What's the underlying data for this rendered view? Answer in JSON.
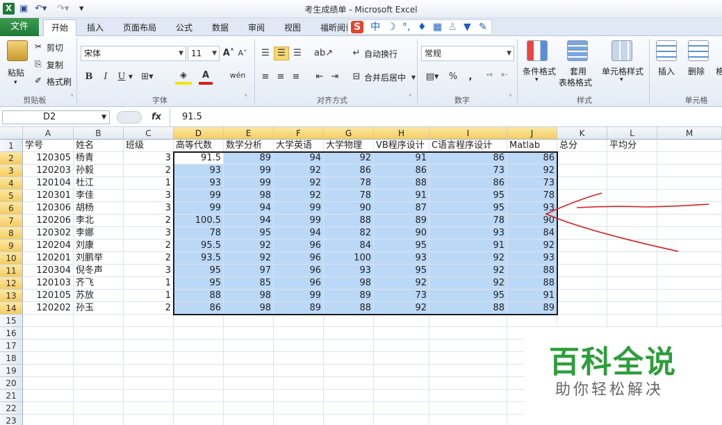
{
  "window": {
    "title": "考生成绩单 - Microsoft Excel"
  },
  "tabs": [
    "文件",
    "开始",
    "插入",
    "页面布局",
    "公式",
    "数据",
    "审阅",
    "视图",
    "福昕阅读"
  ],
  "ime": {
    "label": "中"
  },
  "ribbon": {
    "clipboard": {
      "paste": "粘贴",
      "cut": "剪切",
      "copy": "复制",
      "format_painter": "格式刷",
      "label": "剪贴板"
    },
    "font": {
      "name": "宋体",
      "size": "11",
      "label": "字体",
      "bold": "B",
      "italic": "I",
      "underline": "U"
    },
    "alignment": {
      "wrap": "自动换行",
      "merge": "合并后居中",
      "label": "对齐方式"
    },
    "number": {
      "format": "常规",
      "percent": "%",
      "comma": ",",
      "label": "数字"
    },
    "styles": {
      "conditional": "条件格式",
      "table_format_1": "套用",
      "table_format_2": "表格格式",
      "cell_styles": "单元格样式",
      "label": "样式"
    },
    "cells": {
      "insert": "插入",
      "delete": "删除",
      "format": "格",
      "label": "单元格"
    }
  },
  "formula_bar": {
    "name_box": "D2",
    "fx": "fx",
    "value": "91.5"
  },
  "columns": [
    "A",
    "B",
    "C",
    "D",
    "E",
    "F",
    "G",
    "H",
    "I",
    "J",
    "K",
    "L",
    "M"
  ],
  "rows": [
    "1",
    "2",
    "3",
    "4",
    "5",
    "6",
    "7",
    "8",
    "9",
    "10",
    "11",
    "12",
    "13",
    "14",
    "15",
    "16",
    "17",
    "18",
    "19",
    "20",
    "21",
    "22",
    "23"
  ],
  "headers": [
    "学号",
    "姓名",
    "班级",
    "高等代数",
    "数学分析",
    "大学英语",
    "大学物理",
    "VB程序设计",
    "C语言程序设计",
    "Matlab",
    "总分",
    "平均分",
    ""
  ],
  "table": [
    [
      "120305",
      "杨青",
      "3",
      "91.5",
      "89",
      "94",
      "92",
      "91",
      "86",
      "86"
    ],
    [
      "120203",
      "孙毅",
      "2",
      "93",
      "99",
      "92",
      "86",
      "86",
      "73",
      "92"
    ],
    [
      "120104",
      "杜江",
      "1",
      "93",
      "99",
      "92",
      "78",
      "88",
      "86",
      "73"
    ],
    [
      "120301",
      "李佳",
      "3",
      "99",
      "98",
      "92",
      "78",
      "91",
      "95",
      "78"
    ],
    [
      "120306",
      "胡杨",
      "3",
      "99",
      "94",
      "99",
      "90",
      "87",
      "95",
      "93"
    ],
    [
      "120206",
      "李北",
      "2",
      "100.5",
      "94",
      "99",
      "88",
      "89",
      "78",
      "90"
    ],
    [
      "120302",
      "李娜",
      "3",
      "78",
      "95",
      "94",
      "82",
      "90",
      "93",
      "84"
    ],
    [
      "120204",
      "刘康",
      "2",
      "95.5",
      "92",
      "96",
      "84",
      "95",
      "91",
      "92"
    ],
    [
      "120201",
      "刘鹏举",
      "2",
      "93.5",
      "92",
      "96",
      "100",
      "93",
      "92",
      "93"
    ],
    [
      "120304",
      "倪冬声",
      "3",
      "95",
      "97",
      "96",
      "93",
      "95",
      "92",
      "88"
    ],
    [
      "120103",
      "齐飞",
      "1",
      "95",
      "85",
      "96",
      "98",
      "92",
      "92",
      "88"
    ],
    [
      "120105",
      "苏放",
      "1",
      "88",
      "98",
      "99",
      "89",
      "73",
      "95",
      "91"
    ],
    [
      "120202",
      "孙玉",
      "2",
      "86",
      "98",
      "89",
      "88",
      "92",
      "88",
      "89"
    ]
  ],
  "watermark": {
    "line1": "百科全说",
    "line2": "助你轻松解决"
  },
  "colors": {
    "selection": "#bcd8f7",
    "annotation": "#d42020",
    "header_selected": "#f6cd5f"
  }
}
